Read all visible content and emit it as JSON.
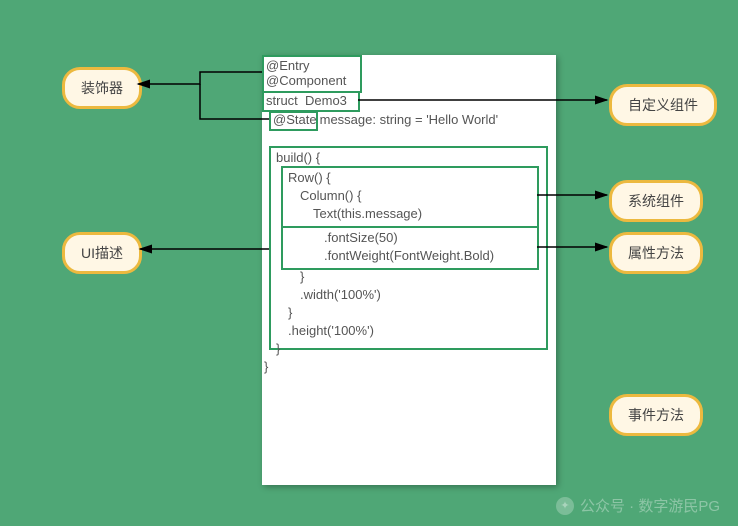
{
  "labels": {
    "decorator": "装饰器",
    "ui_desc": "UI描述",
    "custom_component": "自定义组件",
    "system_component": "系统组件",
    "attribute_method": "属性方法",
    "event_method": "事件方法"
  },
  "code": {
    "line1": "@Entry",
    "line2": "@Component",
    "line3_a": "struct ",
    "line3_b": "Demo3 ",
    "state_tag": "@State",
    "line4_rest": " message: string = 'Hello World'",
    "build_open": "build() {",
    "row_open": "Row() {",
    "col_open": "Column() {",
    "text_call": "Text(this.message)",
    "font_size": ".fontSize(50)",
    "font_weight": ".fontWeight(FontWeight.Bold)",
    "close1": "}",
    "width_call": ".width('100%')",
    "close2": "}",
    "height_call": ".height('100%')",
    "close3": "}",
    "close4": "}"
  },
  "watermark": "公众号 · 数字游民PG"
}
